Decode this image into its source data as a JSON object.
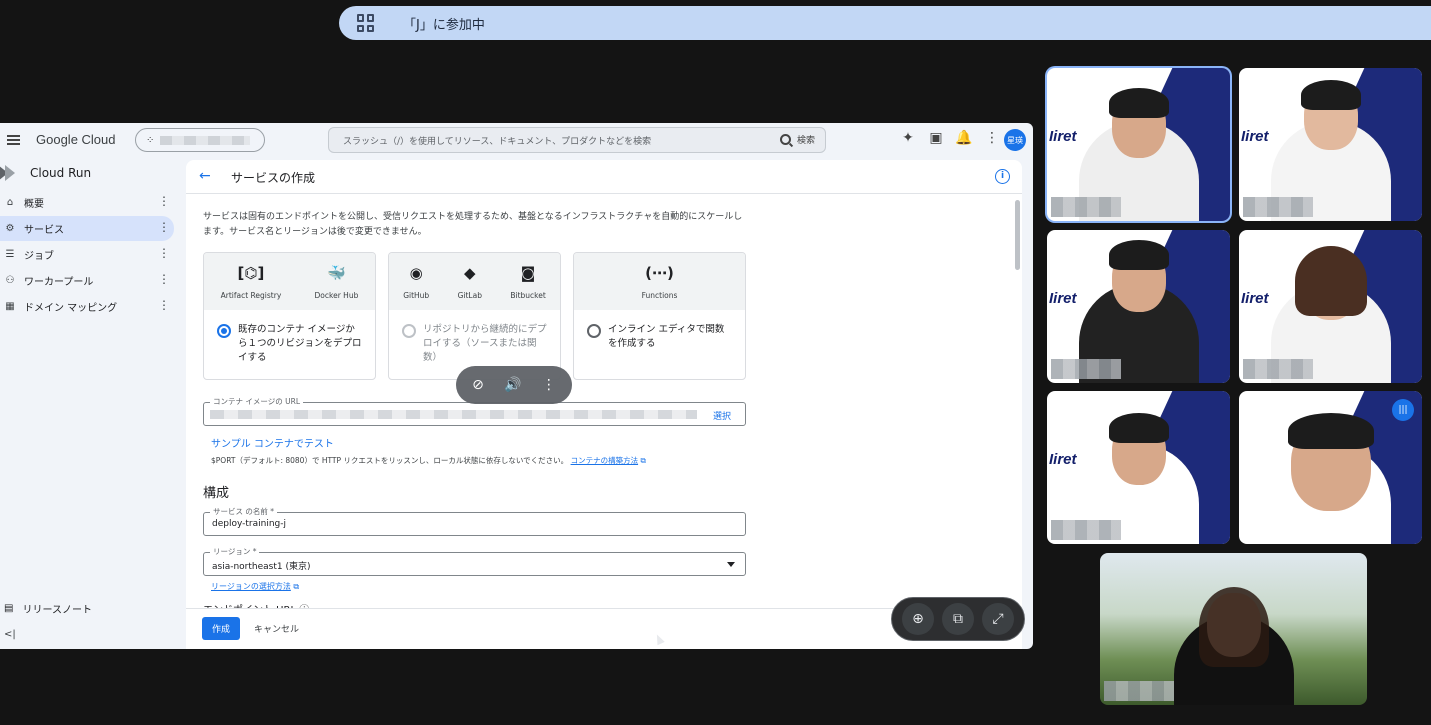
{
  "meet": {
    "banner_text": "「J」に参加中",
    "banner_icon": "grid-view-icon"
  },
  "console": {
    "brand": "Google Cloud",
    "search_placeholder": "スラッシュ（/）を使用してリソース、ドキュメント、プロダクトなどを検索",
    "search_button": "検索",
    "avatar_text": "星瑛",
    "product": "Cloud Run",
    "nav_items": [
      {
        "icon": "⌂",
        "label": "概要"
      },
      {
        "icon": "⚙",
        "label": "サービス"
      },
      {
        "icon": "☰",
        "label": "ジョブ"
      },
      {
        "icon": "⚇",
        "label": "ワーカープール"
      },
      {
        "icon": "▦",
        "label": "ドメイン マッピング"
      }
    ],
    "release_notes": "リリースノート",
    "collapse": "<|"
  },
  "page": {
    "title": "サービスの作成",
    "description": "サービスは固有のエンドポイントを公開し、受信リクエストを処理するため、基盤となるインフラストラクチャを自動的にスケールします。サービス名とリージョンは後で変更できません。",
    "cards": [
      {
        "icons": [
          {
            "glyph": "[⌬]",
            "label": "Artifact Registry"
          },
          {
            "glyph": "🐳",
            "label": "Docker Hub"
          }
        ],
        "option": "既存のコンテナ イメージから１つのリビジョンをデプロイする"
      },
      {
        "icons": [
          {
            "glyph": "◉",
            "label": "GitHub"
          },
          {
            "glyph": "◆",
            "label": "GitLab"
          },
          {
            "glyph": "◙",
            "label": "Bitbucket"
          }
        ],
        "option": "リポジトリから継続的にデプロイする（ソースまたは関数）"
      },
      {
        "icons": [
          {
            "glyph": "(⋯)",
            "label": "Functions"
          }
        ],
        "option": "インライン エディタで関数を作成する"
      }
    ],
    "image_url_label": "コンテナ イメージの URL",
    "select_button": "選択",
    "sample_link": "サンプル コンテナでテスト",
    "port_note": "$PORT（デフォルト: 8080）で HTTP リクエストをリッスンし、ローカル状態に依存しないでください。",
    "build_link": "コンテナの構築方法",
    "section_title": "構成",
    "service_name_label": "サービス の名前 *",
    "service_name_value": "deploy-training-j",
    "region_label": "リージョン *",
    "region_value": "asia-northeast1 (東京)",
    "region_help": "リージョンの選択方法",
    "cutoff_text": "エンドポイント URL ⓘ",
    "create_button": "作成",
    "cancel_button": "キャンセル"
  },
  "share_controls": {
    "unpin": "⊘",
    "volume": "🔊",
    "more": "⋮",
    "zoom": "⊕",
    "popout": "⧉",
    "expand": "⤢"
  },
  "tiles": {
    "logo_text": "Iiret"
  }
}
